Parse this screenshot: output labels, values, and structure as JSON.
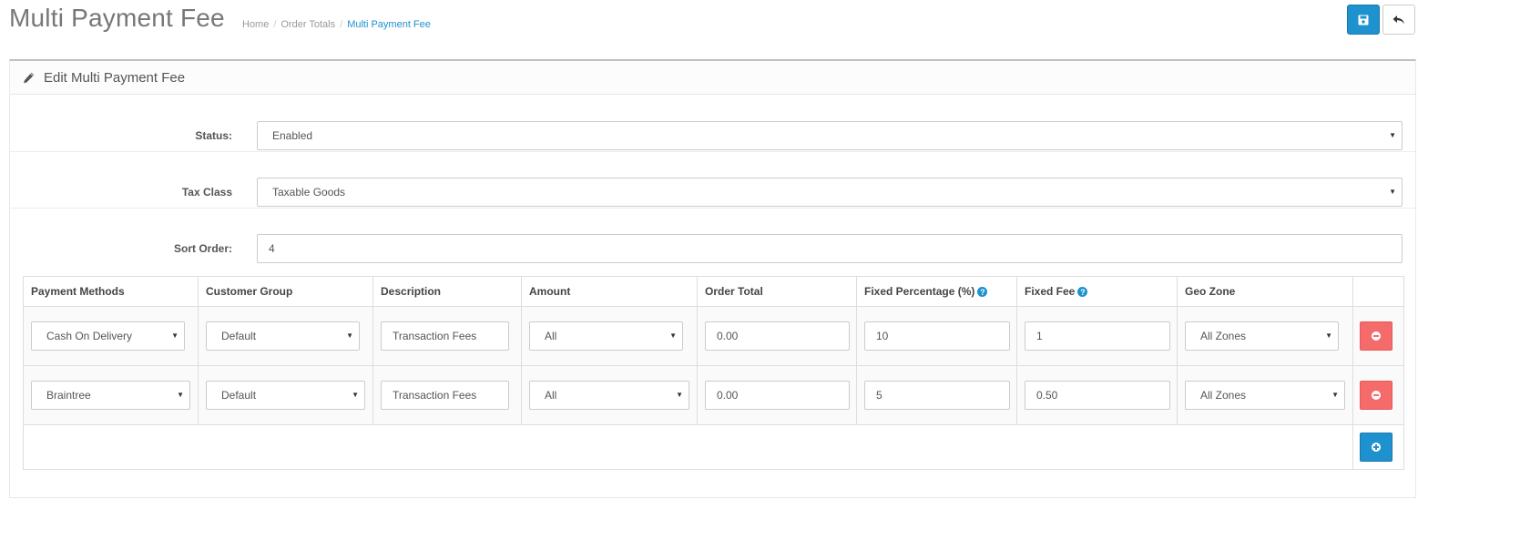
{
  "header": {
    "title": "Multi Payment Fee",
    "breadcrumb": [
      "Home",
      "Order Totals",
      "Multi Payment Fee"
    ],
    "save_icon": "save-icon",
    "back_icon": "reply-icon"
  },
  "panel": {
    "heading": "Edit Multi Payment Fee",
    "heading_icon": "pencil-icon"
  },
  "form": {
    "status": {
      "label": "Status:",
      "value": "Enabled"
    },
    "tax_class": {
      "label": "Tax Class",
      "value": "Taxable Goods"
    },
    "sort_order": {
      "label": "Sort Order:",
      "value": "4"
    }
  },
  "table": {
    "columns": [
      "Payment Methods",
      "Customer Group",
      "Description",
      "Amount",
      "Order Total",
      "Fixed Percentage (%)",
      "Fixed Fee",
      "Geo Zone"
    ],
    "help_columns": [
      "Fixed Percentage (%)",
      "Fixed Fee"
    ],
    "rows": [
      {
        "payment_method": "Cash On Delivery",
        "customer_group": "Default",
        "description": "Transaction Fees",
        "amount": "All",
        "order_total": "0.00",
        "fixed_percentage": "10",
        "fixed_fee": "1",
        "geo_zone": "All Zones"
      },
      {
        "payment_method": "Braintree",
        "customer_group": "Default",
        "description": "Transaction Fees",
        "amount": "All",
        "order_total": "0.00",
        "fixed_percentage": "5",
        "fixed_fee": "0.50",
        "geo_zone": "All Zones"
      }
    ]
  },
  "colors": {
    "primary": "#1e91cf",
    "danger": "#f56b6b",
    "title": "#777777",
    "text": "#555555"
  }
}
